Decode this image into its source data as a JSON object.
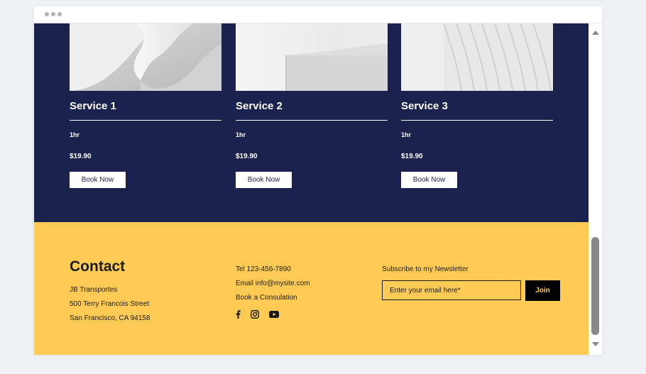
{
  "services": [
    {
      "title": "Service 1",
      "duration": "1hr",
      "price": "$19.90",
      "button": "Book Now",
      "image": "abstract-white-curve"
    },
    {
      "title": "Service 2",
      "duration": "1hr",
      "price": "$19.90",
      "button": "Book Now",
      "image": "abstract-white-steps"
    },
    {
      "title": "Service 3",
      "duration": "1hr",
      "price": "$19.90",
      "button": "Book Now",
      "image": "abstract-white-lines"
    }
  ],
  "contact": {
    "title": "Contact",
    "company": "JB Transportes",
    "street": "500 Terry Francois Street",
    "city": "San Francisco, CA 94158",
    "tel": "Tel 123-456-7890",
    "email": "Email info@mysite.com",
    "book": "Book a Consulation",
    "social_icons": [
      "facebook-icon",
      "instagram-icon",
      "youtube-icon"
    ]
  },
  "newsletter": {
    "label": "Subscribe to my Newsletter",
    "placeholder": "Enter your email here*",
    "button": "Join"
  },
  "colors": {
    "navy": "#1b224d",
    "yellow": "#ffcb55",
    "black": "#000000",
    "white": "#ffffff"
  }
}
